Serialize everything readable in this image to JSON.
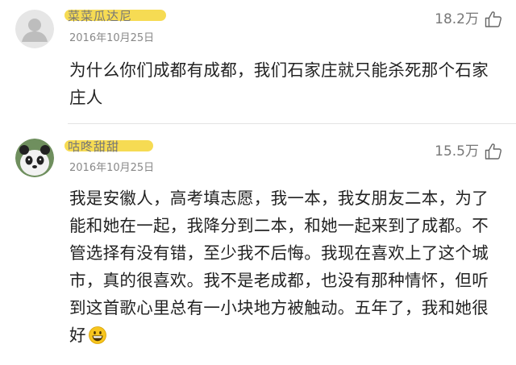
{
  "comments": [
    {
      "username": "菜菜瓜达尼",
      "date": "2016年10月25日",
      "likes": "18.2万",
      "text": "为什么你们成都有成都，我们石家庄就只能杀死那个石家庄人"
    },
    {
      "username": "咕咚甜甜",
      "date": "2016年10月25日",
      "likes": "15.5万",
      "text": "我是安徽人，高考填志愿，我一本，我女朋友二本，为了能和她在一起，我降分到二本，和她一起来到了成都。不管选择有没有错，至少我不后悔。我现在喜欢上了这个城市，真的很喜欢。我不是老成都，也没有那种情怀，但听到这首歌心里总有一小块地方被触动。五年了，我和她很好",
      "emoji": "grinning-face-emoji"
    }
  ],
  "icons": {
    "like": "thumbs-up-icon",
    "avatar_default": "default-avatar-icon",
    "avatar_panda": "panda-avatar"
  },
  "colors": {
    "username_mask": "#f5d94a",
    "text": "#222222",
    "meta": "#888888"
  }
}
